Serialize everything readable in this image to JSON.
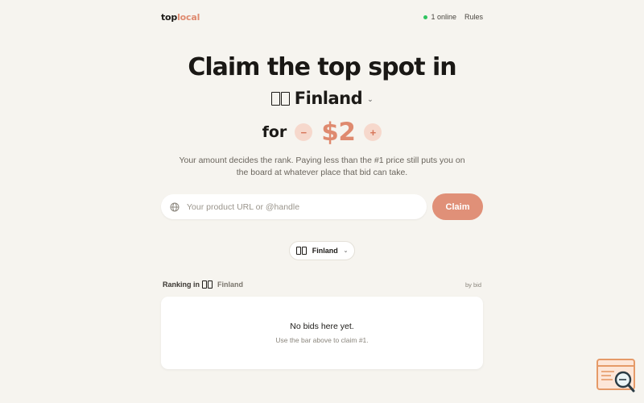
{
  "header": {
    "logo_part1": "top",
    "logo_part2": "local",
    "online_text": "1 online",
    "rules_label": "Rules"
  },
  "hero": {
    "headline": "Claim the top spot in",
    "country": "Finland",
    "for_label": "for",
    "price": "$2",
    "decrement_label": "−",
    "increment_label": "+",
    "description": "Your amount decides the rank. Paying less than the #1 price still puts you on the board at whatever place that bid can take."
  },
  "claim_form": {
    "placeholder": "Your product URL or @handle",
    "value": "",
    "submit_label": "Claim"
  },
  "country_selector": {
    "selected": "Finland"
  },
  "ranking": {
    "title_prefix": "Ranking in",
    "country": "Finland",
    "sort_label": "by bid",
    "empty_title": "No bids here yet.",
    "empty_subtitle": "Use the bar above to claim #1."
  },
  "colors": {
    "accent": "#df8a6f",
    "background": "#f6f4ef",
    "online": "#2fc45f"
  }
}
